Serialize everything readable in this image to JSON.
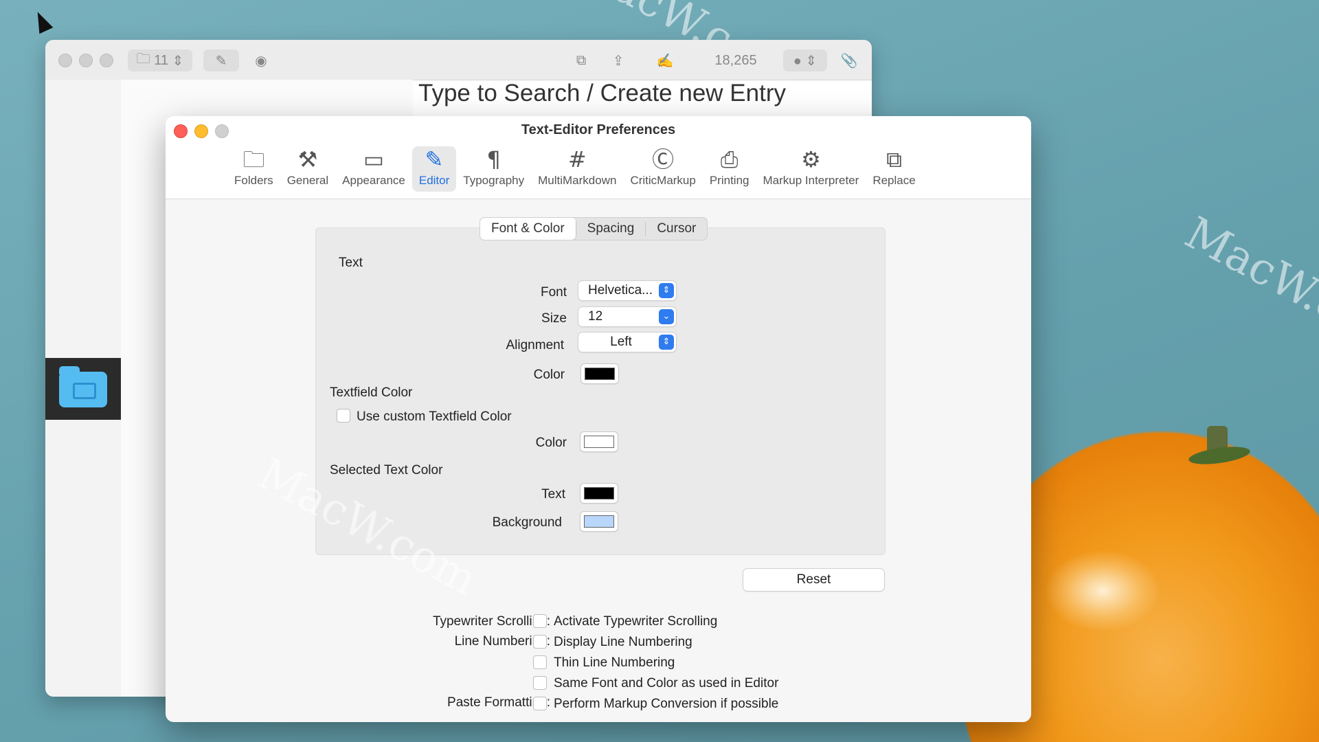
{
  "background_window": {
    "folder_count": "11",
    "count_display": "18,265",
    "search_title": "Type to Search / Create new Entry"
  },
  "watermark_text": "MacW.com",
  "prefs": {
    "title": "Text-Editor Preferences",
    "toolbar": [
      {
        "label": "Folders",
        "icon": "folder-icon",
        "glyph": "🗀"
      },
      {
        "label": "General",
        "icon": "tools-icon",
        "glyph": "⚒"
      },
      {
        "label": "Appearance",
        "icon": "window-icon",
        "glyph": "▭"
      },
      {
        "label": "Editor",
        "icon": "pencil-icon",
        "glyph": "✎",
        "active": true
      },
      {
        "label": "Typography",
        "icon": "pilcrow-icon",
        "glyph": "¶"
      },
      {
        "label": "MultiMarkdown",
        "icon": "hash-icon",
        "glyph": "#"
      },
      {
        "label": "CriticMarkup",
        "icon": "c-frame-icon",
        "glyph": "Ⓒ"
      },
      {
        "label": "Printing",
        "icon": "printer-icon",
        "glyph": "⎙"
      },
      {
        "label": "Markup Interpreter",
        "icon": "gears-icon",
        "glyph": "⚙"
      },
      {
        "label": "Replace",
        "icon": "replace-icon",
        "glyph": "⧉"
      }
    ],
    "tabs": {
      "font_color": "Font & Color",
      "spacing": "Spacing",
      "cursor": "Cursor"
    },
    "text_section": {
      "heading": "Text",
      "font_label": "Font",
      "font_value": "Helvetica...",
      "size_label": "Size",
      "size_value": "12",
      "alignment_label": "Alignment",
      "alignment_value": "Left",
      "color_label": "Color",
      "color_value": "#000000"
    },
    "textfield_section": {
      "heading": "Textfield Color",
      "checkbox_label": "Use custom Textfield Color",
      "color_label": "Color",
      "color_value": "#ffffff"
    },
    "selected_section": {
      "heading": "Selected Text Color",
      "text_label": "Text",
      "text_color": "#000000",
      "background_label": "Background",
      "background_color": "#b9d6fb"
    },
    "reset_label": "Reset",
    "options": {
      "typewriter_label": "Typewriter Scrolling:",
      "typewriter_option": "Activate Typewriter Scrolling",
      "line_numbering_label": "Line Numbering:",
      "display_line_numbering": "Display Line Numbering",
      "thin_line_numbering": "Thin Line Numbering",
      "same_font": "Same Font and Color as used in Editor",
      "paste_label": "Paste Formatting:",
      "paste_option": "Perform Markup Conversion if possible"
    }
  }
}
